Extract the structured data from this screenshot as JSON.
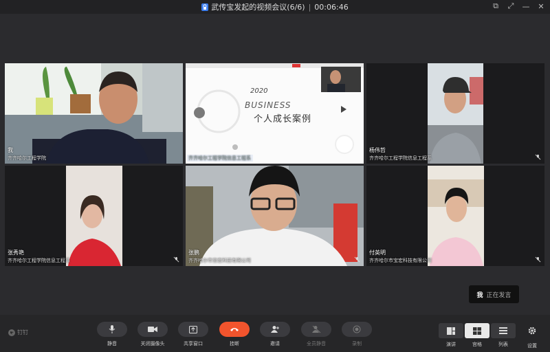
{
  "window": {
    "title": "武传宝发起的视频会议(6/6)",
    "timer": "00:06:46"
  },
  "participants": [
    {
      "name": "我",
      "org": "齐齐哈尔工程学院"
    },
    {
      "name": "",
      "org": "齐齐哈尔工程学院信息工程系"
    },
    {
      "name": "杨伟哲",
      "org": "齐齐哈尔工程学院信息工程系"
    },
    {
      "name": "张秀艳",
      "org": "齐齐哈尔工程学院信息工程系"
    },
    {
      "name": "张鹏",
      "org": "齐齐哈尔市宝宏科技有限公司"
    },
    {
      "name": "付英明",
      "org": "齐齐哈尔市宝宏科技有限公司"
    }
  ],
  "slide": {
    "year": "2020",
    "word": "BUSINESS",
    "title": "个人成长案例"
  },
  "speaking": {
    "name": "我",
    "status": "正在发言"
  },
  "brand": "钉钉",
  "toolbar": {
    "mute": "静音",
    "camera_off": "关闭摄像头",
    "share": "共享窗口",
    "hangup": "挂断",
    "invite": "邀请",
    "mute_all": "全员静音",
    "record": "录制",
    "view_speaker": "演讲",
    "view_grid": "宫格",
    "view_list": "列表",
    "settings": "设置"
  },
  "colors": {
    "active_border": "#2fc15a",
    "hangup": "#f2542d"
  }
}
